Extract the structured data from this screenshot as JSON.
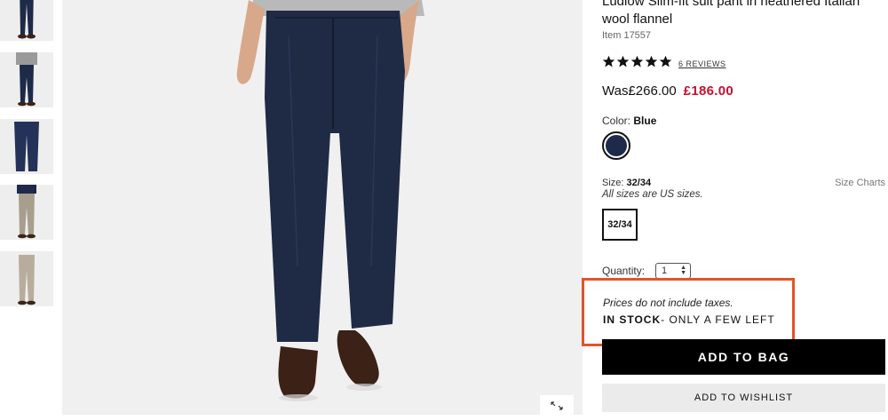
{
  "thumbnails": [
    {
      "name": "navy-suit-front",
      "color": "#1e2a4a"
    },
    {
      "name": "navy-suit-full",
      "color": "#1e2a4a"
    },
    {
      "name": "navy-pants-flat",
      "color": "#243159"
    },
    {
      "name": "khaki-front",
      "color": "#a89e8d"
    },
    {
      "name": "khaki-full",
      "color": "#b8ad9c"
    }
  ],
  "product": {
    "title": "Ludlow Slim-fit suit pant in heathered Italian wool flannel",
    "item_number": "Item 17557",
    "rating_stars": 5,
    "reviews_link": "6 REVIEWS",
    "was_price": "Was£266.00",
    "sale_price": "£186.00",
    "color_label": "Color:",
    "color_value": "Blue",
    "swatch_color": "#1e2a4a",
    "size_label": "Size:",
    "size_value": "32/34",
    "size_note": "All sizes are US sizes.",
    "size_charts_link": "Size Charts",
    "size_option": "32/34",
    "quantity_label": "Quantity:",
    "quantity_value": "1",
    "tax_notice": "Prices do not include taxes.",
    "stock_status": "IN STOCK",
    "stock_detail": "- ONLY A FEW LEFT",
    "add_to_bag": "ADD TO BAG",
    "add_to_wishlist": "ADD TO WISHLIST"
  },
  "colors": {
    "sale": "#c8102e",
    "highlight_border": "#e0552b",
    "primary_button": "#000000"
  },
  "icons": {
    "expand": "expand-icon",
    "star": "star-icon"
  }
}
